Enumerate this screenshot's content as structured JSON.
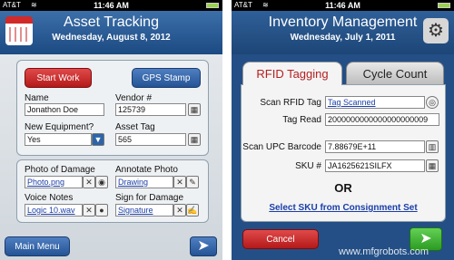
{
  "left": {
    "status": {
      "carrier": "AT&T",
      "time": "11:46 AM"
    },
    "header": {
      "title": "Asset Tracking",
      "date": "Wednesday, August 8, 2012"
    },
    "buttons": {
      "start_work": "Start Work",
      "gps_stamp": "GPS Stamp",
      "main_menu": "Main Menu"
    },
    "form": {
      "name_label": "Name",
      "name_value": "Jonathon Doe",
      "vendor_label": "Vendor #",
      "vendor_value": "125739",
      "new_equipment_label": "New Equipment?",
      "new_equipment_value": "Yes",
      "asset_tag_label": "Asset Tag",
      "asset_tag_value": "565"
    },
    "media": {
      "photo_label": "Photo of Damage",
      "photo_value": "Photo.png",
      "annotate_label": "Annotate Photo",
      "annotate_value": "Drawing",
      "voice_label": "Voice Notes",
      "voice_value": "Logic 10.wav",
      "sign_label": "Sign for Damage",
      "sign_value": "Signature"
    }
  },
  "right": {
    "status": {
      "carrier": "AT&T",
      "time": "11:46 AM"
    },
    "header": {
      "title": "Inventory Management",
      "date": "Wednesday, July 1, 2011"
    },
    "tabs": {
      "rfid": "RFID Tagging",
      "cycle": "Cycle Count"
    },
    "form": {
      "scan_rfid_label": "Scan RFID Tag",
      "scan_rfid_value": "Tag Scanned",
      "tag_read_label": "Tag Read",
      "tag_read_value": "2000000000000000000009",
      "scan_upc_label": "Scan UPC Barcode",
      "scan_upc_value": "7.88679E+11",
      "sku_label": "SKU #",
      "sku_value": "JA1625621SILFX",
      "or_text": "OR",
      "select_sku_link": "Select SKU from Consignment Set"
    },
    "buttons": {
      "cancel": "Cancel"
    }
  },
  "watermark": "www.mfgrobots.com"
}
